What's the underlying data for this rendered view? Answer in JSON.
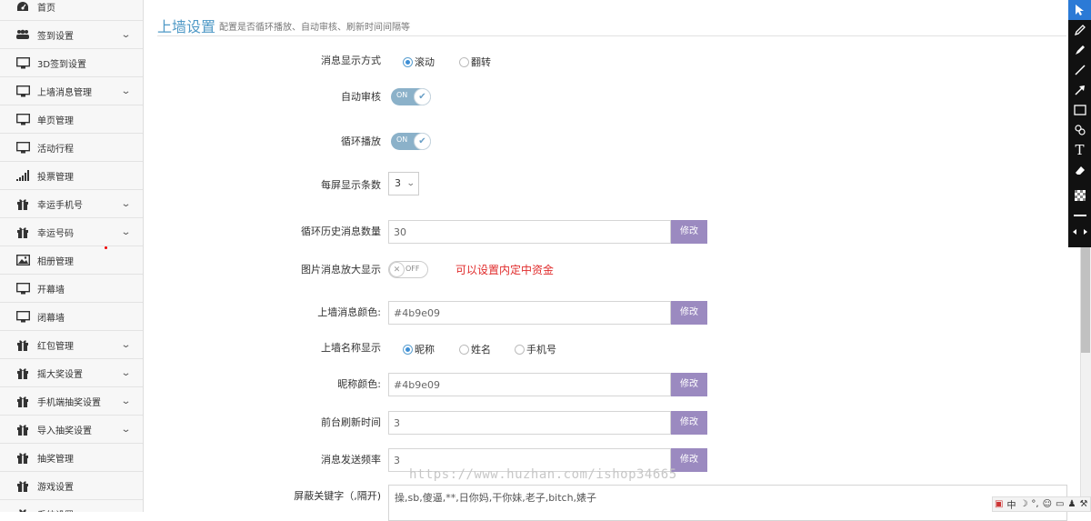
{
  "sidebar": {
    "items": [
      {
        "label": "首页",
        "icon": "dashboard-icon",
        "chevron": false
      },
      {
        "label": "签到设置",
        "icon": "users-icon",
        "chevron": true
      },
      {
        "label": "3D签到设置",
        "icon": "monitor-icon",
        "chevron": false
      },
      {
        "label": "上墙消息管理",
        "icon": "monitor-icon",
        "chevron": true
      },
      {
        "label": "单页管理",
        "icon": "monitor-icon",
        "chevron": false
      },
      {
        "label": "活动行程",
        "icon": "monitor-icon",
        "chevron": false
      },
      {
        "label": "投票管理",
        "icon": "signal-icon",
        "chevron": false
      },
      {
        "label": "幸运手机号",
        "icon": "gift-icon",
        "chevron": true
      },
      {
        "label": "幸运号码",
        "icon": "gift-icon",
        "chevron": true
      },
      {
        "label": "相册管理",
        "icon": "picture-icon",
        "chevron": false
      },
      {
        "label": "开幕墙",
        "icon": "monitor-icon",
        "chevron": false
      },
      {
        "label": "闭幕墙",
        "icon": "monitor-icon",
        "chevron": false
      },
      {
        "label": "红包管理",
        "icon": "gift-icon",
        "chevron": true
      },
      {
        "label": "摇大奖设置",
        "icon": "gift-icon",
        "chevron": true
      },
      {
        "label": "手机端抽奖设置",
        "icon": "gift-icon",
        "chevron": true
      },
      {
        "label": "导入抽奖设置",
        "icon": "gift-icon",
        "chevron": true
      },
      {
        "label": "抽奖管理",
        "icon": "gift-icon",
        "chevron": false
      },
      {
        "label": "游戏设置",
        "icon": "gift-icon",
        "chevron": false
      },
      {
        "label": "系统设置",
        "icon": "gift-icon",
        "chevron": true
      }
    ]
  },
  "header": {
    "title": "上墙设置",
    "subtitle": "配置是否循环播放、自动审核、刷新时间间隔等"
  },
  "form": {
    "display_mode": {
      "label": "消息显示方式",
      "options": [
        "滚动",
        "翻转"
      ],
      "selected": "滚动"
    },
    "auto_review": {
      "label": "自动审核",
      "state": "ON"
    },
    "loop_play": {
      "label": "循环播放",
      "state": "ON"
    },
    "per_screen": {
      "label": "每屏显示条数",
      "value": "3"
    },
    "history_count": {
      "label": "循环历史消息数量",
      "value": "30",
      "button": "修改"
    },
    "image_zoom": {
      "label": "图片消息放大显示",
      "state": "OFF",
      "note": "可以设置内定中资金"
    },
    "msg_color": {
      "label": "上墙消息颜色:",
      "value": "#4b9e09",
      "button": "修改"
    },
    "name_display": {
      "label": "上墙名称显示",
      "options": [
        "昵称",
        "姓名",
        "手机号"
      ],
      "selected": "昵称"
    },
    "nick_color": {
      "label": "昵称颜色:",
      "value": "#4b9e09",
      "button": "修改"
    },
    "refresh_time": {
      "label": "前台刷新时间",
      "value": "3",
      "button": "修改"
    },
    "send_rate": {
      "label": "消息发送频率",
      "value": "3",
      "button": "修改"
    },
    "block_keywords": {
      "label": "屏蔽关键字（,隔开)",
      "value": "操,sb,傻逼,**,日你妈,干你妹,老子,bitch,婊子"
    }
  },
  "watermark": "https://www.huzhan.com/ishop34665",
  "ime": {
    "lang": "中"
  },
  "colors": {
    "accent": "#4f99c6",
    "button": "#9b8ac0",
    "note": "#e02b2b"
  }
}
